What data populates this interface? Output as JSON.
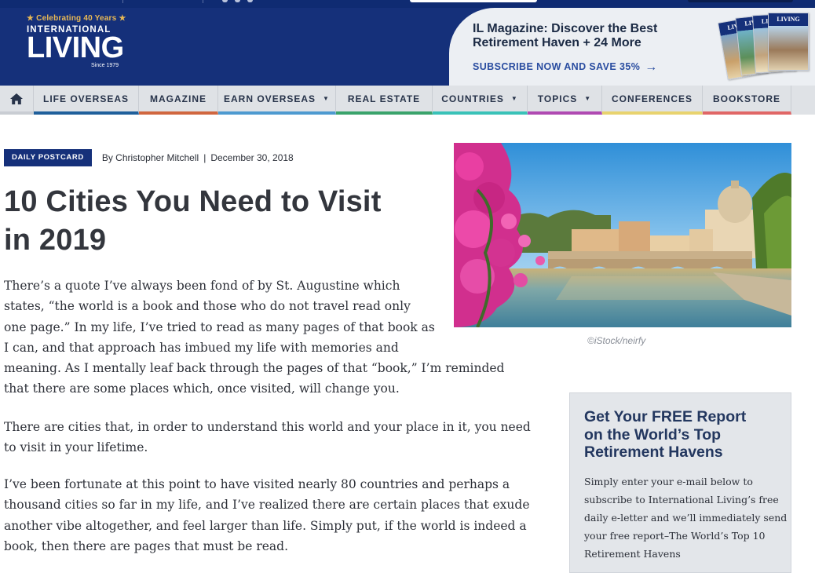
{
  "logo": {
    "tagline": "★ Celebrating 40 Years ★",
    "name_line1": "INTERNATIONAL",
    "name_line2": "LIVING",
    "since": "Since 1979"
  },
  "promo": {
    "title": "IL Magazine: Discover the Best Retirement Haven + 24 More",
    "cta": "SUBSCRIBE NOW AND SAVE 35%",
    "magazine_masthead": "LIVING"
  },
  "nav": {
    "home_icon": "home-icon",
    "items": [
      {
        "label": "LIFE OVERSEAS",
        "dropdown": false,
        "accent": "#1f5f9b"
      },
      {
        "label": "MAGAZINE",
        "dropdown": false,
        "accent": "#d0663f"
      },
      {
        "label": "EARN OVERSEAS",
        "dropdown": true,
        "accent": "#4d9ad0"
      },
      {
        "label": "REAL ESTATE",
        "dropdown": false,
        "accent": "#3aa36b"
      },
      {
        "label": "COUNTRIES",
        "dropdown": true,
        "accent": "#39c2b8"
      },
      {
        "label": "TOPICS",
        "dropdown": true,
        "accent": "#b04ab2"
      },
      {
        "label": "CONFERENCES",
        "dropdown": false,
        "accent": "#e8d36e"
      },
      {
        "label": "BOOKSTORE",
        "dropdown": false,
        "accent": "#e06666"
      }
    ]
  },
  "article": {
    "category": "DAILY POSTCARD",
    "author": "By Christopher Mitchell",
    "date": "December 30, 2018",
    "title_line1": "10 Cities You Need to Visit",
    "title_line2": "in 2019",
    "paragraphs": [
      [
        "There’s a quote I’ve always been fond of by St. Augustine which",
        "states, “the world is a book and those who do not travel read only",
        "one page.” In my life, I’ve tried to read as many pages of that book as",
        "I can, and that approach has imbued my life with memories and",
        "meaning. As I mentally leaf back through the pages of that “book,” I’m reminded",
        "that there are some places which, once visited, will change you."
      ],
      [
        "There are cities that, in order to understand this world and your place in it, you need",
        "to visit in your lifetime."
      ],
      [
        "I’ve been fortunate at this point to have visited nearly 80 countries and perhaps a",
        "thousand cities so far in my life, and I’ve realized there are certain places that exude",
        "another vibe altogether, and feel larger than life. Simply put, if the world is indeed a",
        "book, then there are pages that must be read."
      ]
    ],
    "image_credit": "©iStock/neirfy"
  },
  "signup": {
    "title_lines": [
      "Get Your FREE Report",
      "on the World’s Top",
      "Retirement Havens"
    ],
    "body_lines": [
      "Simply enter your e-mail below to",
      "subscribe to International Living’s free",
      "daily e-letter and we’ll immediately send",
      "your free report–The World’s Top 10",
      "Retirement Havens"
    ]
  },
  "colors": {
    "brand_navy": "#15307a",
    "badge": "#15307a",
    "cta_blue": "#2a4da0",
    "gold": "#e9b955"
  }
}
